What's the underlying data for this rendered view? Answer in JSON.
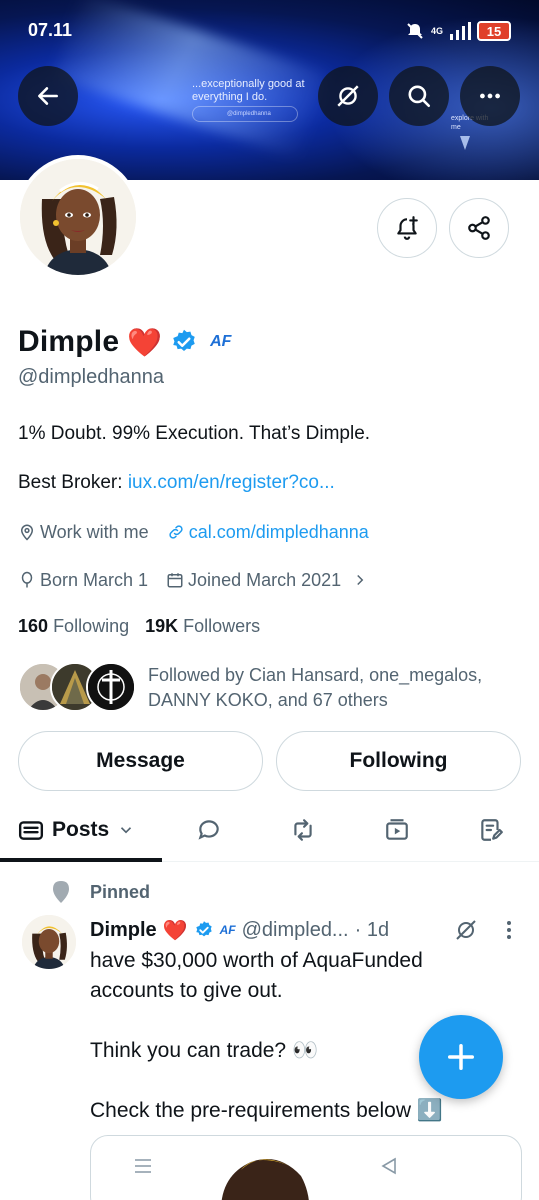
{
  "status_bar": {
    "time": "07.11",
    "network": "4G",
    "battery": "15"
  },
  "banner": {
    "tagline": "...exceptionally good at everything I do.",
    "pill_text": "@dimpledhanna",
    "explore_text": "explore with me"
  },
  "profile": {
    "name": "Dimple",
    "name_emoji": "❤️",
    "affiliate_badge": "AF",
    "handle": "@dimpledhanna",
    "bio": "1% Doubt. 99% Execution. That’s Dimple.",
    "broker_label": "Best Broker:",
    "broker_link": "iux.com/en/register?co...",
    "location": "Work with me",
    "website": "cal.com/dimpledhanna",
    "birthday": "Born March 1",
    "joined": "Joined March 2021",
    "following_count": "160",
    "following_label": "Following",
    "followers_count": "19K",
    "followers_label": "Followers",
    "followed_by": "Followed by Cian Hansard, one_megalos, DANNY KOKO, and 67 others"
  },
  "actions": {
    "message": "Message",
    "following": "Following"
  },
  "tabs": {
    "posts": "Posts"
  },
  "post": {
    "pinned_label": "Pinned",
    "author": "Dimple",
    "author_emoji": "❤️",
    "badge": "AF",
    "handle": "@dimpled...",
    "time": "· 1d",
    "body": "have $30,000 worth of AquaFunded accounts to give out.\n\nThink you can trade? 👀\n\nCheck the pre-requirements below ⬇️"
  },
  "colors": {
    "accent": "#1d9bf0",
    "text": "#0f1419",
    "muted": "#536471",
    "border": "#cfd9de",
    "heart": "#e0245e"
  },
  "icons": [
    "back-arrow-icon",
    "grok-icon",
    "search-icon",
    "more-icon",
    "bell-plus-icon",
    "share-icon",
    "verified-icon",
    "location-icon",
    "link-icon",
    "balloon-icon",
    "calendar-icon",
    "chevron-right-icon",
    "chevron-down-icon",
    "chat-bubble-icon",
    "repost-icon",
    "video-icon",
    "article-icon",
    "pin-icon",
    "plus-icon"
  ]
}
